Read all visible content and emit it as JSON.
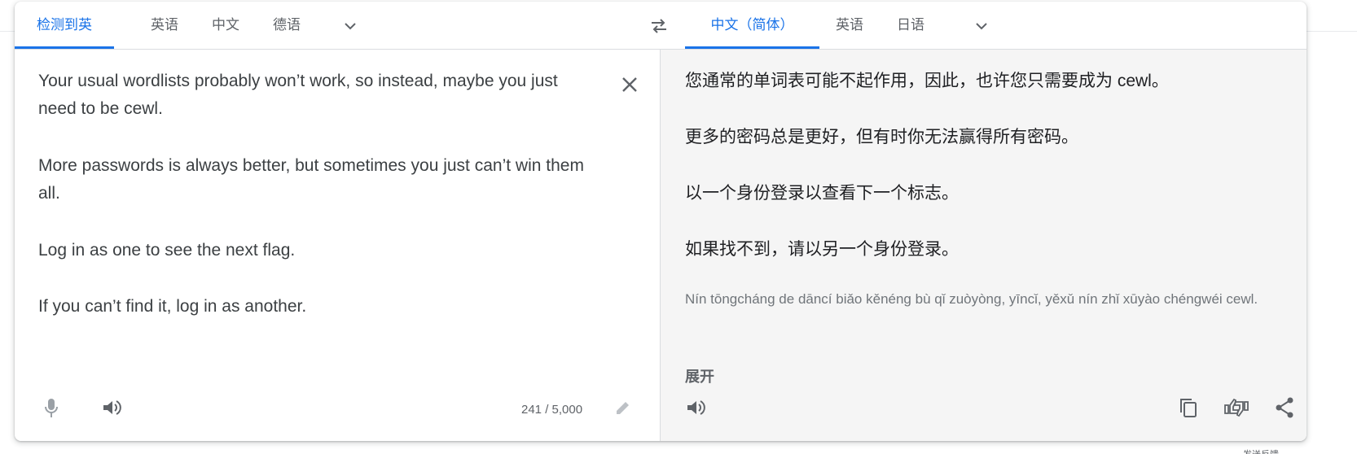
{
  "source": {
    "tabs": [
      "检测到英语",
      "英语",
      "中文",
      "德语"
    ],
    "active_tab": "检测到英语",
    "paragraphs": [
      "Your usual wordlists probably won’t work, so instead, maybe you just need to be cewl.",
      "More passwords is always better, but sometimes you just can’t win them all.",
      "Log in as one to see the next flag.",
      "If you can’t find it, log in as another."
    ],
    "char_count": "241 / 5,000"
  },
  "target": {
    "tabs": [
      "中文（简体）",
      "英语",
      "日语"
    ],
    "active_tab": "中文（简体）",
    "paragraphs": [
      "您通常的单词表可能不起作用，因此，也许您只需要成为 cewl。",
      "更多的密码总是更好，但有时你无法赢得所有密码。",
      "以一个身份登录以查看下一个标志。",
      "如果找不到，请以另一个身份登录。"
    ],
    "pinyin": "Nín tōngcháng de dāncí biǎo kěnéng bù qǐ zuòyòng, yīncǐ, yěxǔ nín zhǐ xūyào chéngwéi cewl.",
    "expand_label": "展开"
  },
  "footer_fragment": "发送反馈",
  "colors": {
    "accent": "#1a73e8",
    "text": "#3c4043",
    "muted": "#5f6368",
    "target_bg": "#f5f5f5"
  },
  "icons": [
    "chevron-down-icon",
    "swap-languages-icon",
    "close-icon",
    "microphone-icon",
    "speaker-icon",
    "edit-pencil-icon",
    "copy-icon",
    "rate-translation-icon",
    "share-icon"
  ]
}
